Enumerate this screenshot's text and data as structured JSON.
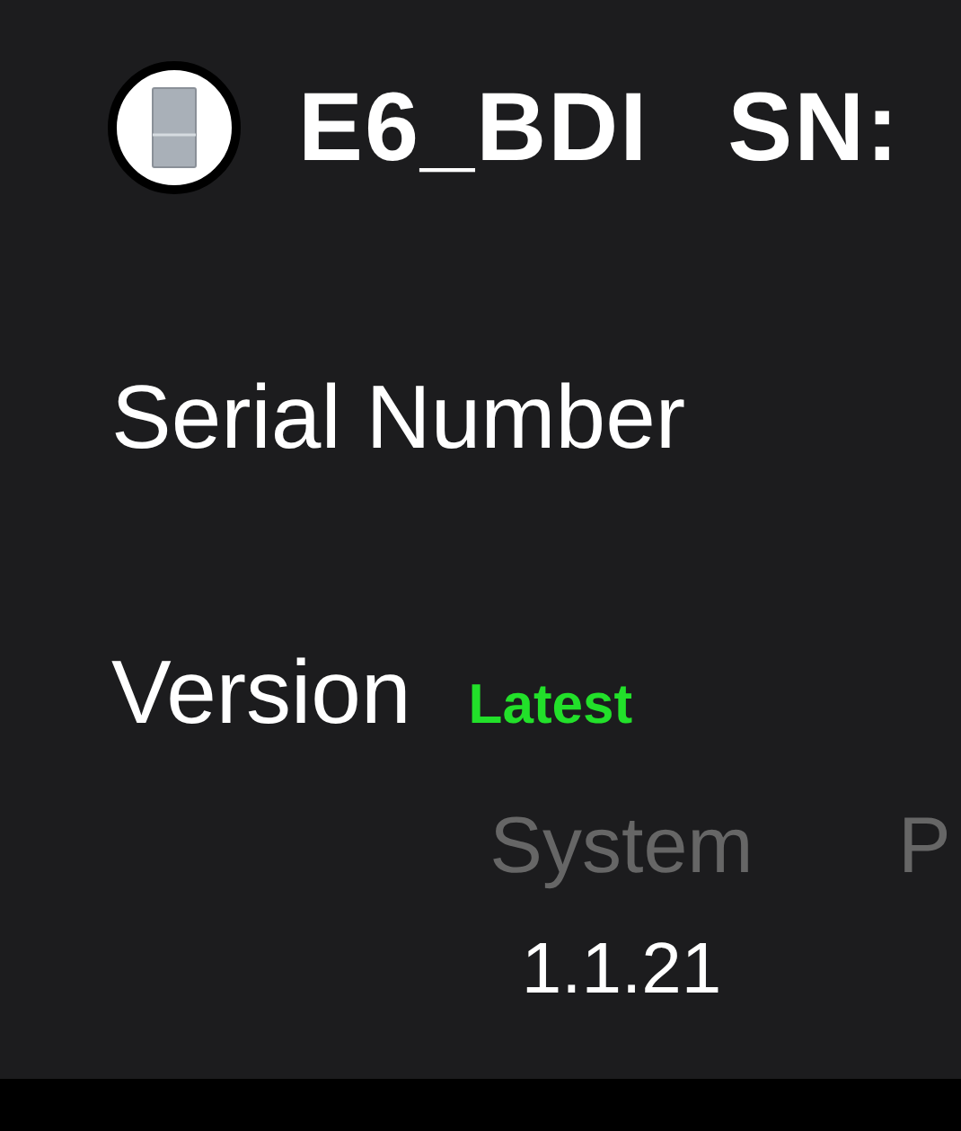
{
  "header": {
    "title": "E6_BDI",
    "serial_label": "SN:"
  },
  "serial_number": {
    "label": "Serial Number"
  },
  "version": {
    "label": "Version",
    "badge": "Latest"
  },
  "version_columns": [
    {
      "label": "System",
      "value": "1.1.21"
    },
    {
      "label": "P"
    }
  ]
}
